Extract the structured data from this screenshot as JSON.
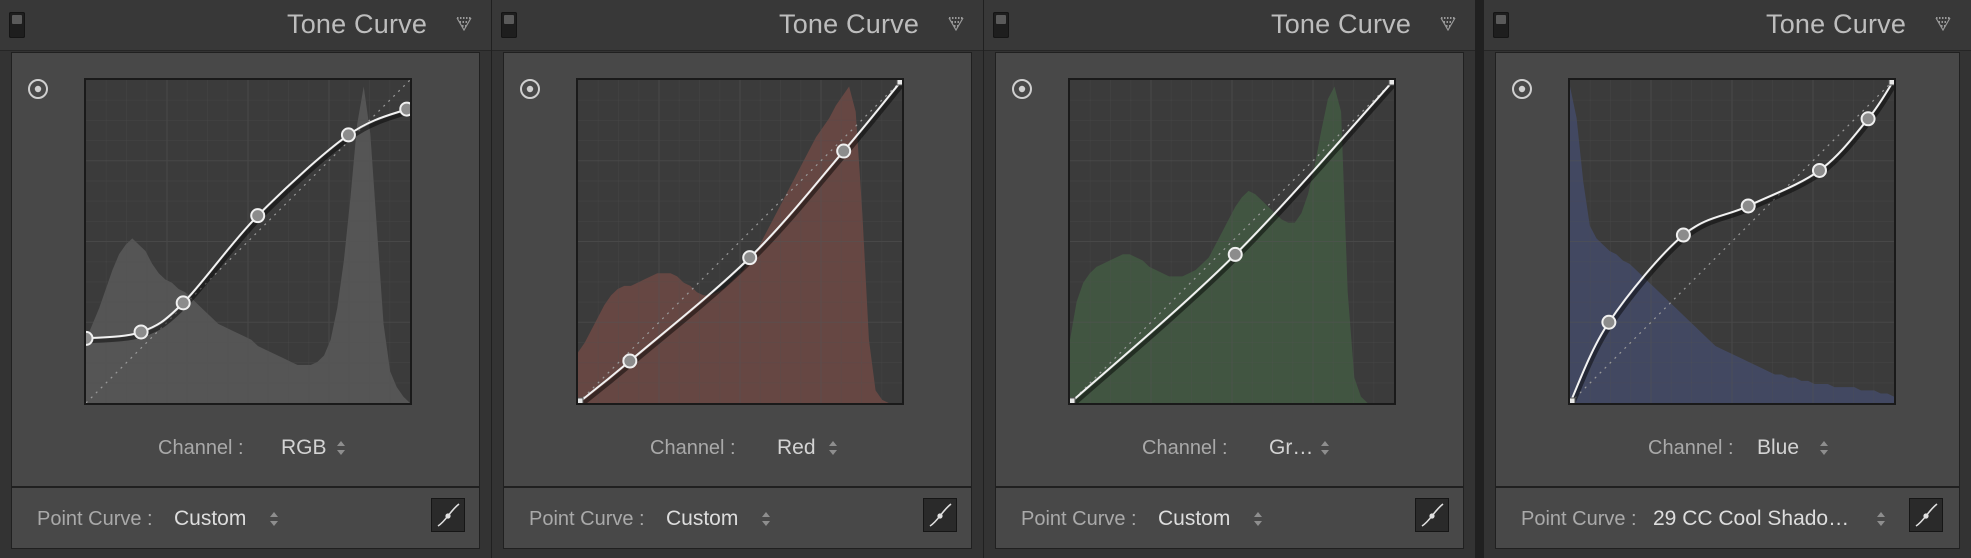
{
  "panels": [
    {
      "title": "Tone Curve",
      "channel_label": "Channel :",
      "channel_value": "RGB",
      "point_curve_label": "Point Curve :",
      "point_curve_value": "Custom",
      "histogram_color": "#5a5a5a",
      "histogram": [
        0.2,
        0.25,
        0.3,
        0.36,
        0.42,
        0.47,
        0.5,
        0.52,
        0.5,
        0.48,
        0.44,
        0.41,
        0.39,
        0.38,
        0.36,
        0.35,
        0.33,
        0.31,
        0.29,
        0.27,
        0.25,
        0.24,
        0.23,
        0.22,
        0.21,
        0.2,
        0.18,
        0.17,
        0.16,
        0.15,
        0.14,
        0.13,
        0.12,
        0.12,
        0.12,
        0.13,
        0.15,
        0.2,
        0.3,
        0.45,
        0.65,
        0.88,
        1.0,
        0.85,
        0.55,
        0.25,
        0.1,
        0.05,
        0.02,
        0.0
      ],
      "curve_points": [
        [
          0,
          0.2
        ],
        [
          0.17,
          0.22
        ],
        [
          0.3,
          0.31
        ],
        [
          0.53,
          0.58
        ],
        [
          0.81,
          0.83
        ],
        [
          0.99,
          0.91
        ]
      ],
      "endpoints": []
    },
    {
      "title": "Tone Curve",
      "channel_label": "Channel :",
      "channel_value": "Red",
      "point_curve_label": "Point Curve :",
      "point_curve_value": "Custom",
      "histogram_color": "#6e4a45",
      "histogram": [
        0.16,
        0.19,
        0.23,
        0.27,
        0.31,
        0.34,
        0.36,
        0.37,
        0.37,
        0.38,
        0.39,
        0.4,
        0.41,
        0.41,
        0.41,
        0.4,
        0.38,
        0.37,
        0.35,
        0.34,
        0.34,
        0.35,
        0.36,
        0.38,
        0.4,
        0.42,
        0.45,
        0.48,
        0.52,
        0.56,
        0.6,
        0.64,
        0.68,
        0.72,
        0.76,
        0.8,
        0.84,
        0.87,
        0.9,
        0.94,
        0.97,
        1.0,
        0.92,
        0.6,
        0.2,
        0.04,
        0.01,
        0.0,
        0.0,
        0.0
      ],
      "curve_points": [
        [
          0,
          0
        ],
        [
          0.16,
          0.13
        ],
        [
          0.53,
          0.45
        ],
        [
          0.82,
          0.78
        ],
        [
          1,
          1
        ]
      ],
      "endpoints": [
        0,
        4
      ]
    },
    {
      "title": "Tone Curve",
      "channel_label": "Channel :",
      "channel_value": "Gr…",
      "point_curve_label": "Point Curve :",
      "point_curve_value": "Custom",
      "histogram_color": "#435a43",
      "histogram": [
        0.2,
        0.32,
        0.38,
        0.41,
        0.43,
        0.44,
        0.45,
        0.46,
        0.47,
        0.47,
        0.46,
        0.45,
        0.43,
        0.42,
        0.41,
        0.4,
        0.4,
        0.4,
        0.41,
        0.42,
        0.44,
        0.46,
        0.5,
        0.54,
        0.58,
        0.62,
        0.65,
        0.67,
        0.66,
        0.64,
        0.62,
        0.6,
        0.58,
        0.57,
        0.57,
        0.6,
        0.66,
        0.75,
        0.86,
        0.96,
        1.0,
        0.92,
        0.35,
        0.08,
        0.02,
        0.0,
        0.0,
        0.0,
        0.0,
        0.0
      ],
      "curve_points": [
        [
          0,
          0
        ],
        [
          0.51,
          0.46
        ],
        [
          1,
          1
        ]
      ],
      "endpoints": [
        0,
        2
      ]
    },
    {
      "title": "Tone Curve",
      "channel_label": "Channel :",
      "channel_value": "Blue",
      "point_curve_label": "Point Curve :",
      "point_curve_value": "29 CC Cool Shado…",
      "histogram_color": "#444b68",
      "histogram": [
        1.0,
        0.9,
        0.7,
        0.56,
        0.52,
        0.5,
        0.48,
        0.47,
        0.45,
        0.44,
        0.42,
        0.4,
        0.38,
        0.36,
        0.34,
        0.32,
        0.3,
        0.28,
        0.26,
        0.24,
        0.22,
        0.2,
        0.18,
        0.17,
        0.16,
        0.15,
        0.14,
        0.13,
        0.12,
        0.11,
        0.1,
        0.09,
        0.09,
        0.08,
        0.08,
        0.07,
        0.07,
        0.06,
        0.06,
        0.06,
        0.05,
        0.05,
        0.05,
        0.05,
        0.04,
        0.04,
        0.04,
        0.03,
        0.03,
        0.02
      ],
      "curve_points": [
        [
          0,
          0
        ],
        [
          0.12,
          0.25
        ],
        [
          0.35,
          0.52
        ],
        [
          0.55,
          0.61
        ],
        [
          0.77,
          0.72
        ],
        [
          0.92,
          0.88
        ],
        [
          1,
          1
        ]
      ],
      "endpoints": [
        0,
        6
      ]
    }
  ]
}
